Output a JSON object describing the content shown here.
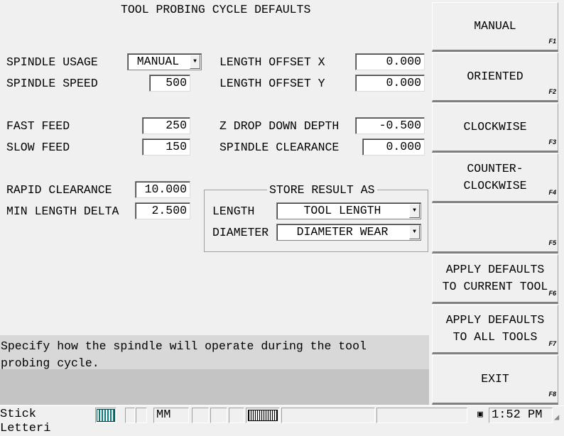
{
  "title": "TOOL PROBING CYCLE DEFAULTS",
  "fields": {
    "spindle_usage": {
      "label": "SPINDLE USAGE",
      "value": "MANUAL"
    },
    "spindle_speed": {
      "label": "SPINDLE SPEED",
      "value": "500"
    },
    "fast_feed": {
      "label": "FAST FEED",
      "value": "250"
    },
    "slow_feed": {
      "label": "SLOW FEED",
      "value": "150"
    },
    "rapid_clearance": {
      "label": "RAPID CLEARANCE",
      "value": "10.000"
    },
    "min_length_delta": {
      "label": "MIN LENGTH DELTA",
      "value": "2.500"
    },
    "length_offset_x": {
      "label": "LENGTH OFFSET X",
      "value": "0.000"
    },
    "length_offset_y": {
      "label": "LENGTH OFFSET Y",
      "value": "0.000"
    },
    "z_drop_down_depth": {
      "label": "Z DROP DOWN DEPTH",
      "value": "-0.500"
    },
    "spindle_clearance": {
      "label": "SPINDLE CLEARANCE",
      "value": "0.000"
    }
  },
  "store_result": {
    "title": "STORE RESULT AS",
    "length_label": "LENGTH",
    "length_value": "TOOL LENGTH",
    "diameter_label": "DIAMETER",
    "diameter_value": "DIAMETER WEAR"
  },
  "help_text": "Specify how the spindle will operate during the tool\nprobing cycle.",
  "softkeys": [
    {
      "label": "MANUAL",
      "key": "F1"
    },
    {
      "label": "ORIENTED",
      "key": "F2"
    },
    {
      "label": "CLOCKWISE",
      "key": "F3"
    },
    {
      "label": "COUNTER-\nCLOCKWISE",
      "key": "F4"
    },
    {
      "label": "",
      "key": "F5"
    },
    {
      "label": "APPLY DEFAULTS\nTO CURRENT TOOL",
      "key": "F6"
    },
    {
      "label": "APPLY DEFAULTS\nTO ALL TOOLS",
      "key": "F7"
    },
    {
      "label": "EXIT",
      "key": "F8"
    }
  ],
  "statusbar": {
    "font_name": "Stick Letteri",
    "units": "MM",
    "time": "1:52 PM"
  }
}
